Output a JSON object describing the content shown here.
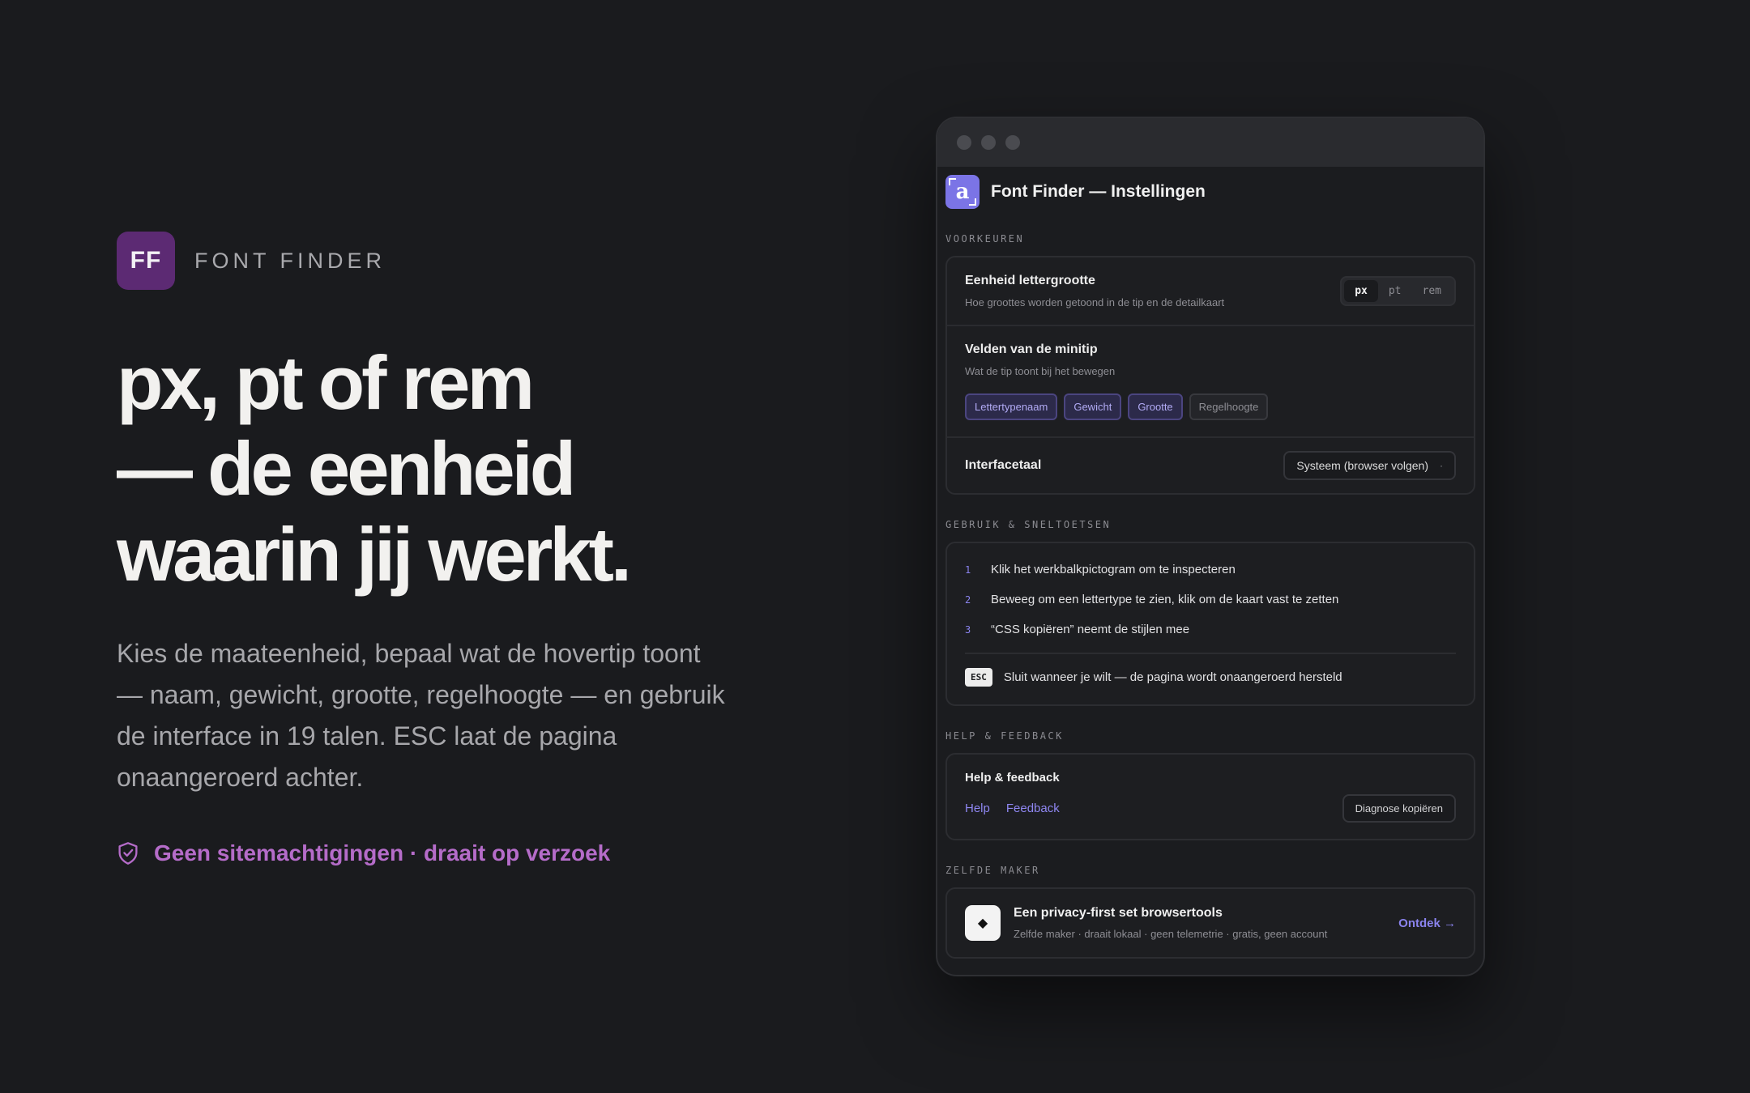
{
  "hero": {
    "logo_text": "FF",
    "brand_name": "FONT FINDER",
    "headline": [
      "px, pt of rem",
      "— de eenheid",
      "waarin jij werkt."
    ],
    "lede": "Kies de maateenheid, bepaal wat de hovertip toont — naam, gewicht, grootte, regelhoogte — en gebruik de interface in 19 talen. ESC laat de pagina onaangeroerd achter.",
    "permission_note": "Geen sitemachtigingen · draait op verzoek",
    "permission_icon": "shield-check-icon",
    "accent_color": "#b56cc9"
  },
  "window": {
    "app_logo_letter": "a",
    "title": "Font Finder — Instellingen",
    "accent_color": "#7b74e6",
    "preferences": {
      "section_label": "VOORKEUREN",
      "unit": {
        "title": "Eenheid lettergrootte",
        "subtitle": "Hoe groottes worden getoond in de tip en de detailkaart",
        "options": [
          "px",
          "pt",
          "rem"
        ],
        "selected": "px"
      },
      "fields": {
        "title": "Velden van de minitip",
        "subtitle": "Wat de tip toont bij het bewegen",
        "chips": [
          {
            "label": "Lettertypenaam",
            "active": true
          },
          {
            "label": "Gewicht",
            "active": true
          },
          {
            "label": "Grootte",
            "active": true
          },
          {
            "label": "Regelhoogte",
            "active": false
          }
        ]
      },
      "language": {
        "title": "Interfacetaal",
        "value": "Systeem (browser volgen)",
        "caret": "·"
      }
    },
    "usage": {
      "section_label": "GEBRUIK & SNELTOETSEN",
      "steps": [
        {
          "num": "1",
          "text": "Klik het werkbalkpictogram om te inspecteren"
        },
        {
          "num": "2",
          "text": "Beweeg om een lettertype te zien, klik om de kaart vast te zetten"
        },
        {
          "num": "3",
          "text": "“CSS kopiëren” neemt de stijlen mee"
        }
      ],
      "esc_key": "ESC",
      "esc_text": "Sluit wanneer je wilt — de pagina wordt onaangeroerd hersteld"
    },
    "help": {
      "section_label": "HELP & FEEDBACK",
      "title": "Help & feedback",
      "link_help": "Help",
      "link_feedback": "Feedback",
      "button_label": "Diagnose kopiëren"
    },
    "maker": {
      "section_label": "ZELFDE MAKER",
      "icon": "diamond-icon",
      "title": "Een privacy-first set browsertools",
      "subtitle": "Zelfde maker · draait lokaal · geen telemetrie · gratis, geen account",
      "link": "Ontdek →"
    }
  }
}
